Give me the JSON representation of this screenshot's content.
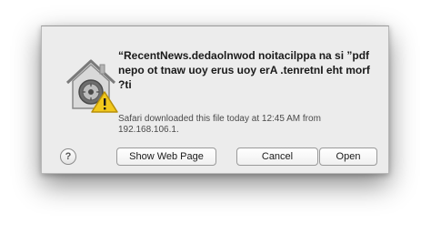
{
  "dialog": {
    "message": "“RecentNews.dedaolnwod noitacilppa na si ”pdf nepo ot tnaw uoy erus uoy erA .tenretnI eht morf ?ti",
    "info": "Safari downloaded this file today at 12:45 AM from 192.168.106.1.",
    "help_label": "?",
    "buttons": {
      "show_web_page": "Show Web Page",
      "cancel": "Cancel",
      "open": "Open"
    },
    "icons": {
      "main": "gatekeeper-house-lock-icon",
      "warning": "warning-triangle-icon"
    },
    "colors": {
      "dialog_bg": "#ececec",
      "warning_yellow": "#f2c81c"
    }
  }
}
